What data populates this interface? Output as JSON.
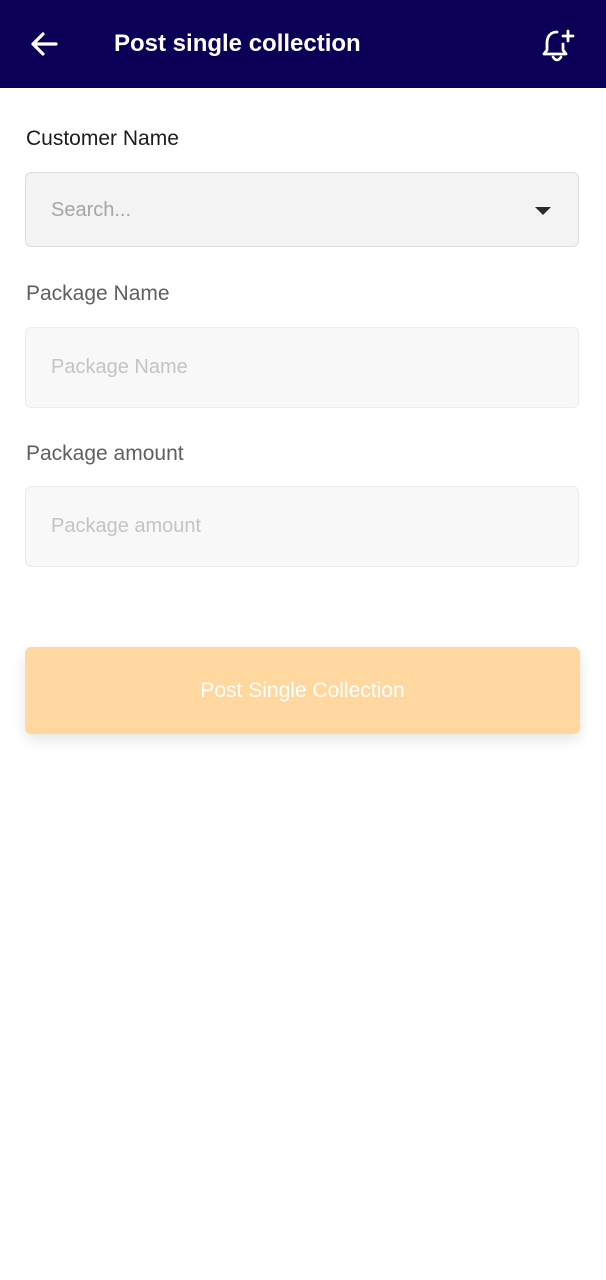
{
  "header": {
    "title": "Post single collection",
    "background_color": "#0a0058",
    "back_icon": "arrow-left-icon",
    "action_icon": "bell-plus-icon"
  },
  "form": {
    "customer_name": {
      "label": "Customer Name",
      "placeholder": "Search..."
    },
    "package_name": {
      "label": "Package Name",
      "placeholder": "Package Name",
      "value": ""
    },
    "package_amount": {
      "label": "Package amount",
      "placeholder": "Package amount",
      "value": ""
    },
    "submit_label": "Post Single Collection",
    "submit_color": "#ffd79f"
  }
}
